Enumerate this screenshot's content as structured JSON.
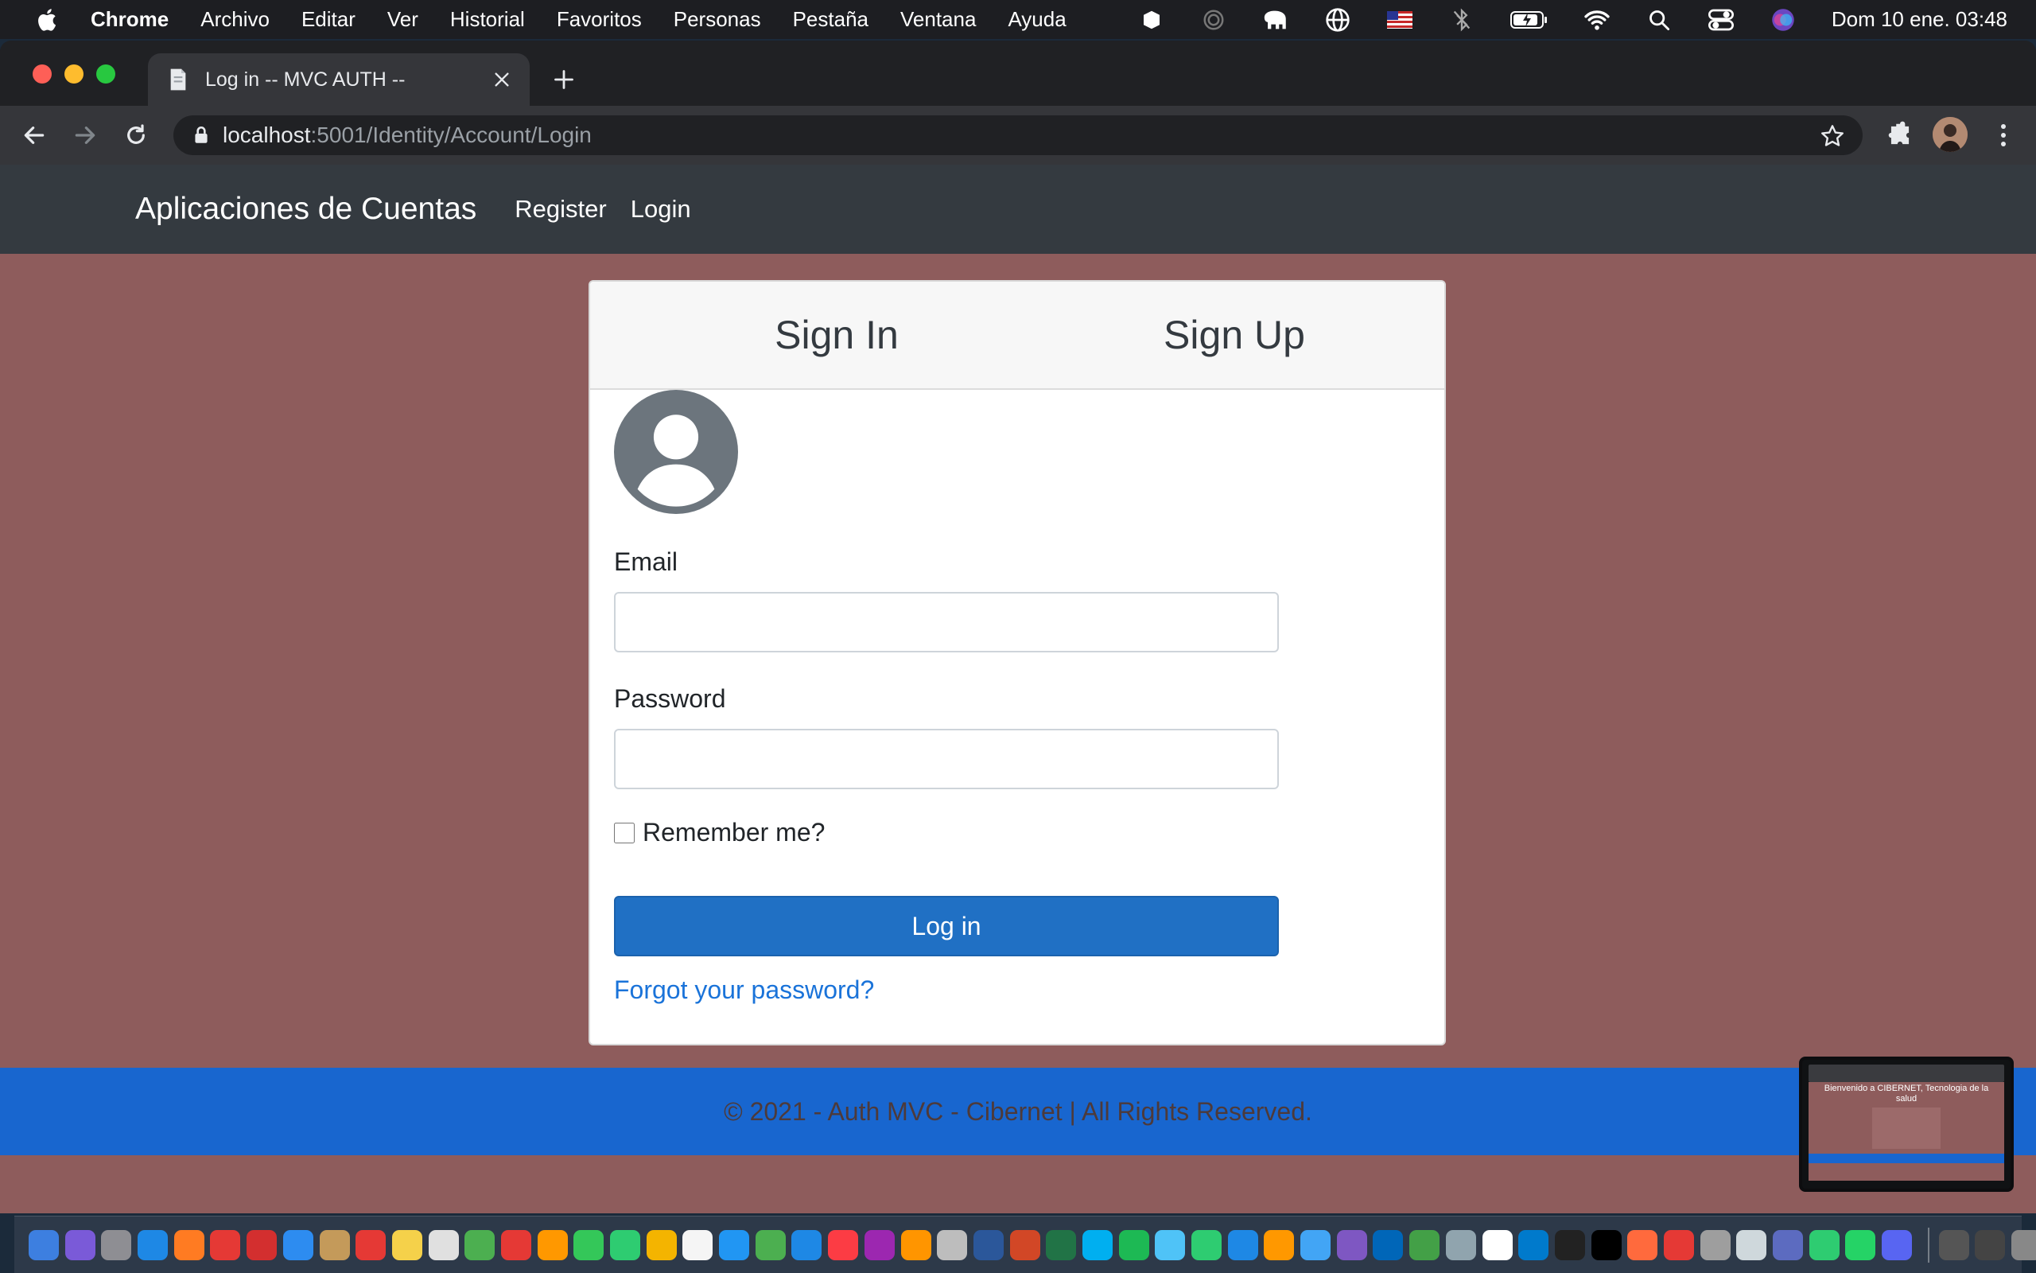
{
  "menubar": {
    "app_name": "Chrome",
    "items": [
      "Archivo",
      "Editar",
      "Ver",
      "Historial",
      "Favoritos",
      "Personas",
      "Pestaña",
      "Ventana",
      "Ayuda"
    ],
    "clock": "Dom 10 ene.  03:48"
  },
  "browser": {
    "tab_title": "Log in -- MVC AUTH --",
    "url_host": "localhost",
    "url_path": ":5001/Identity/Account/Login"
  },
  "site": {
    "brand": "Aplicaciones de Cuentas",
    "nav_register": "Register",
    "nav_login": "Login",
    "tab_signin": "Sign In",
    "tab_signup": "Sign Up",
    "email_label": "Email",
    "email_value": "",
    "password_label": "Password",
    "password_value": "",
    "remember_label": "Remember me?",
    "login_button": "Log in",
    "forgot_link": "Forgot your password?",
    "footer": "© 2021 - Auth MVC - Cibernet | All Rights Reserved."
  },
  "thumbnail": {
    "text": "Bienvenido a CIBERNET, Tecnologia de la salud"
  },
  "dock_colors": [
    "#3d7fe0",
    "#7a5ad8",
    "#8e8e93",
    "#1e88e5",
    "#ff7b22",
    "#e53935",
    "#d32f2f",
    "#2d8cf0",
    "#c49a5a",
    "#e53935",
    "#f5d14a",
    "#e0e0e0",
    "#4caf50",
    "#e53935",
    "#ff9800",
    "#34c759",
    "#2ecc71",
    "#f4b400",
    "#f5f5f5",
    "#2196f3",
    "#4caf50",
    "#1e88e5",
    "#fc3c44",
    "#9c27b0",
    "#ff9500",
    "#bdbdbd",
    "#2b579a",
    "#d24726",
    "#217346",
    "#00aff0",
    "#1db954",
    "#4fc3f7",
    "#2ecc71",
    "#1e88e5",
    "#ff9800",
    "#42a5f5",
    "#7e57c2",
    "#0066b8",
    "#43a047",
    "#90a4ae",
    "#ffffff",
    "#007acc",
    "#222222",
    "#000000",
    "#ff6a3d",
    "#e53935",
    "#9e9e9e",
    "#cfd8dc",
    "#5c6bc0",
    "#2ecc71",
    "#25d366",
    "#5865f2"
  ],
  "dock_colors_right": [
    "#555555",
    "#444444",
    "#888888"
  ]
}
